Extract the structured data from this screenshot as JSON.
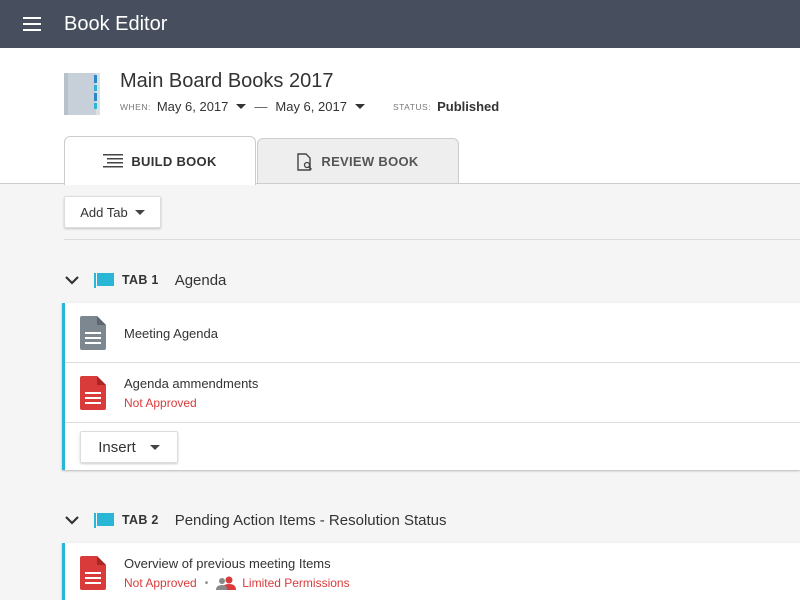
{
  "app": {
    "title": "Book Editor"
  },
  "book": {
    "title": "Main Board Books 2017",
    "when_label": "WHEN:",
    "start_date": "May 6, 2017",
    "date_separator": "—",
    "end_date": "May 6, 2017",
    "status_label": "STATUS:",
    "status": "Published"
  },
  "tabs": {
    "build": "BUILD BOOK",
    "review": "REVIEW BOOK",
    "active": "build"
  },
  "toolbar": {
    "add_tab": "Add Tab"
  },
  "sections": [
    {
      "tab_label": "TAB 1",
      "name": "Agenda",
      "items": [
        {
          "title": "Meeting Agenda",
          "status": "",
          "icon": "gray-document-icon"
        },
        {
          "title": "Agenda ammendments",
          "status": "Not Approved",
          "icon": "red-document-icon"
        }
      ],
      "insert_label": "Insert"
    },
    {
      "tab_label": "TAB 2",
      "name": "Pending Action Items - Resolution Status",
      "items": [
        {
          "title": "Overview of previous meeting Items",
          "status": "Not Approved",
          "separator": "•",
          "permissions": "Limited Permissions",
          "icon": "red-document-icon"
        }
      ]
    }
  ],
  "colors": {
    "appbar": "#474f5e",
    "accent": "#2ab7d5",
    "error": "#d93b3b",
    "doc_gray": "#7d8790",
    "doc_red": "#d93b3b"
  }
}
